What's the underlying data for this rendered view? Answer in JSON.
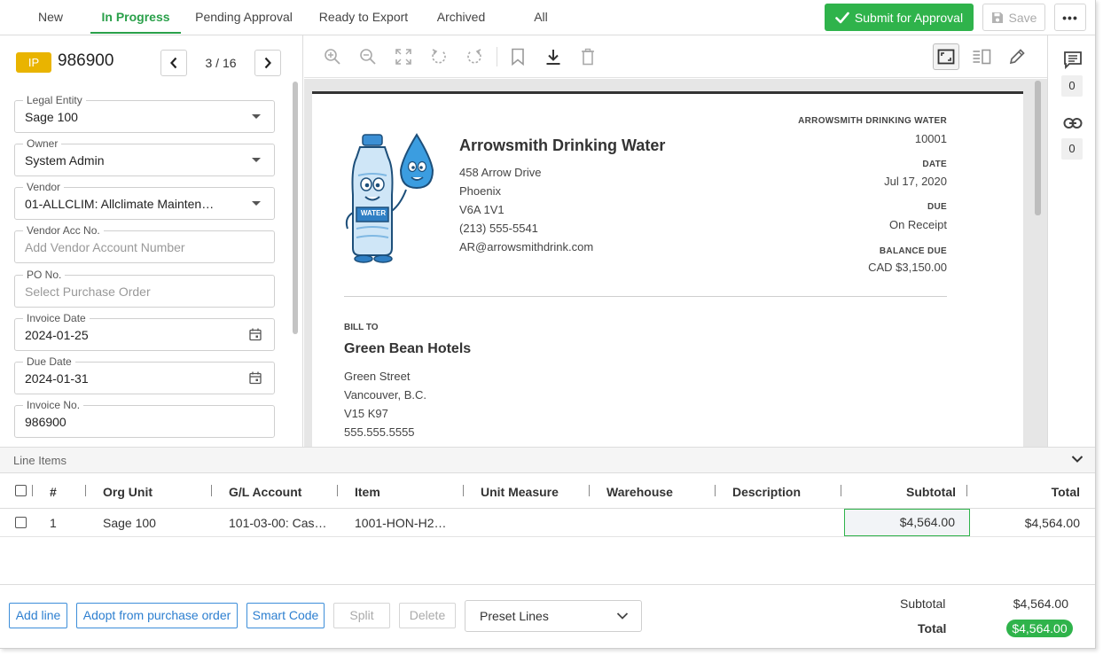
{
  "tabs": [
    {
      "label": "New"
    },
    {
      "label": "In Progress"
    },
    {
      "label": "Pending Approval"
    },
    {
      "label": "Ready to Export"
    },
    {
      "label": "Archived"
    },
    {
      "label": "All"
    }
  ],
  "actions": {
    "submit_label": "Submit for Approval",
    "save_label": "Save",
    "more_label": "•••"
  },
  "doc": {
    "status": "IP",
    "number": "986900",
    "pager": "3 / 16"
  },
  "form": {
    "legal_entity": {
      "label": "Legal Entity",
      "value": "Sage 100"
    },
    "owner": {
      "label": "Owner",
      "value": "System Admin"
    },
    "vendor": {
      "label": "Vendor",
      "value": "01-ALLCLIM: Allclimate Mainten…"
    },
    "vendor_acc": {
      "label": "Vendor Acc No.",
      "placeholder": "Add Vendor Account Number"
    },
    "po_no": {
      "label": "PO No.",
      "placeholder": "Select Purchase Order"
    },
    "invoice_date": {
      "label": "Invoice Date",
      "value": "2024-01-25"
    },
    "due_date": {
      "label": "Due Date",
      "value": "2024-01-31"
    },
    "invoice_no": {
      "label": "Invoice No.",
      "value": "986900"
    }
  },
  "invoice": {
    "company_name": "Arrowsmith Drinking Water",
    "address_lines": [
      "458 Arrow Drive",
      "Phoenix",
      "V6A 1V1",
      "(213) 555-5541",
      "AR@arrowsmithdrink.com"
    ],
    "header_company": "ARROWSMITH DRINKING WATER",
    "header_number": "10001",
    "date_label": "DATE",
    "date_value": "Jul 17, 2020",
    "due_label": "DUE",
    "due_value": "On Receipt",
    "balance_label": "BALANCE DUE",
    "balance_value": "CAD $3,150.00",
    "logo_text": "WATER",
    "bill_to_label": "BILL TO",
    "bill_to_name": "Green Bean Hotels",
    "bill_to_lines": [
      "Green Street",
      "Vancouver, B.C.",
      "V15 K97",
      "555.555.5555"
    ]
  },
  "rail": {
    "comments_count": "0",
    "links_count": "0"
  },
  "line_items": {
    "title": "Line Items",
    "columns": [
      "#",
      "Org Unit",
      "G/L Account",
      "Item",
      "Unit Measure",
      "Warehouse",
      "Description",
      "Subtotal",
      "Total"
    ],
    "rows": [
      {
        "num": "1",
        "org_unit": "Sage 100",
        "gl_account": "101-03-00: Cas…",
        "item": "1001-HON-H2…",
        "unit_measure": "",
        "warehouse": "",
        "description": "",
        "subtotal": "$4,564.00",
        "total": "$4,564.00"
      }
    ]
  },
  "footer": {
    "add_line": "Add line",
    "adopt_po": "Adopt from purchase order",
    "smart_code": "Smart Code",
    "split": "Split",
    "delete": "Delete",
    "preset_lines": "Preset Lines",
    "subtotal_label": "Subtotal",
    "subtotal_value": "$4,564.00",
    "total_label": "Total",
    "total_value": "$4,564.00"
  },
  "colors": {
    "accent_green": "#2fb34b",
    "status_yellow": "#e9b400",
    "link_blue": "#2d7fd0"
  }
}
